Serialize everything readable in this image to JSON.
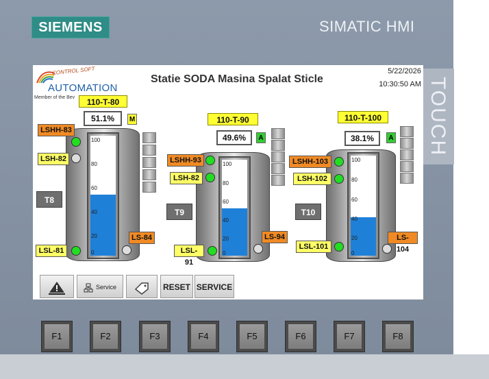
{
  "device": {
    "brand": "SIEMENS",
    "model": "SIMATIC HMI",
    "touch_label": "TOUCH",
    "function_keys": [
      "F1",
      "F2",
      "F3",
      "F4",
      "F5",
      "F6",
      "F7",
      "F8"
    ]
  },
  "screen": {
    "logo": {
      "top": "CONTROL SOFT",
      "main": "AUTOMATION",
      "sub": "Member of the Bev"
    },
    "title": "Statie SODA Masina Spalat Sticle",
    "date": "5/22/2026",
    "time": "10:30:50 AM",
    "scale_labels": [
      "100",
      "80",
      "60",
      "40",
      "20",
      "0"
    ],
    "tanks": [
      {
        "tank_button": "T8",
        "level_tag": "110-T-80",
        "level_value": "51.1%",
        "level_percent": 51.1,
        "mode": "M",
        "switch_hh": "LSHH-83",
        "switch_h": "LSH-82",
        "switch_low": "LSL-81",
        "switch_ls": "LS-84",
        "lamp_hh": "on",
        "lamp_h": "off",
        "lamp_low": "on",
        "lamp_ls": "off"
      },
      {
        "tank_button": "T9",
        "level_tag": "110-T-90",
        "level_value": "49.6%",
        "level_percent": 49.6,
        "mode": "A",
        "switch_hh": "LSHH-93",
        "switch_h": "LSH-82",
        "switch_low": "LSL-91",
        "switch_ls": "LS-94",
        "lamp_hh": "on",
        "lamp_h": "on",
        "lamp_low": "on",
        "lamp_ls": "off"
      },
      {
        "tank_button": "T10",
        "level_tag": "110-T-100",
        "level_value": "38.1%",
        "level_percent": 38.1,
        "mode": "A",
        "switch_hh": "LSHH-103",
        "switch_h": "LSH-102",
        "switch_low": "LSL-101",
        "switch_ls": "LS-104",
        "lamp_hh": "on",
        "lamp_h": "on",
        "lamp_low": "on",
        "lamp_ls": "off"
      }
    ],
    "bottom_buttons": {
      "service_small": "Service",
      "reset": "RESET",
      "service": "SERVICE"
    }
  }
}
